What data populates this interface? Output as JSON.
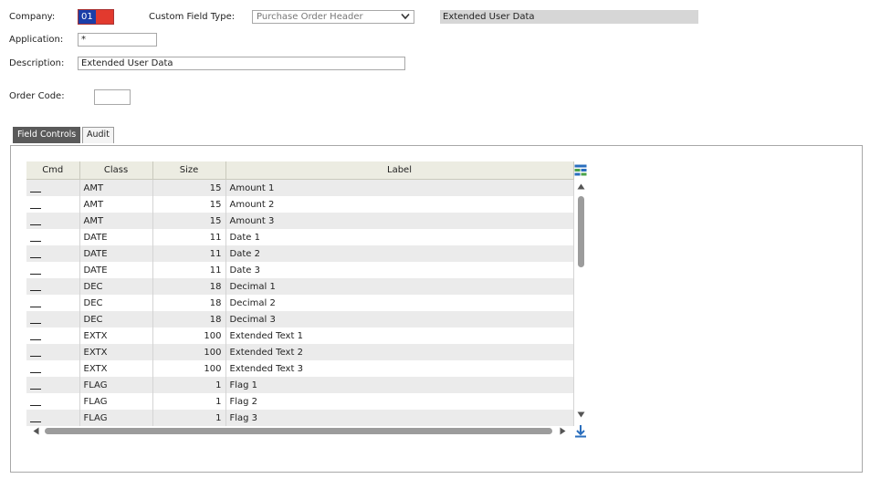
{
  "header": {
    "company_label": "Company:",
    "company_value": "01",
    "custom_field_type_label": "Custom Field Type:",
    "custom_field_type_value": "Purchase Order Header",
    "custom_field_type_desc": "Extended User Data",
    "application_label": "Application:",
    "application_value": "*",
    "description_label": "Description:",
    "description_value": "Extended User Data",
    "order_code_label": "Order Code:",
    "order_code_value": ""
  },
  "tabs": [
    {
      "label": "Field Controls",
      "active": true
    },
    {
      "label": "Audit",
      "active": false
    }
  ],
  "grid": {
    "columns": [
      "Cmd",
      "Class",
      "Size",
      "Label"
    ],
    "rows": [
      {
        "cmd": "",
        "class": "AMT",
        "size": "15",
        "label": "Amount 1"
      },
      {
        "cmd": "",
        "class": "AMT",
        "size": "15",
        "label": "Amount 2"
      },
      {
        "cmd": "",
        "class": "AMT",
        "size": "15",
        "label": "Amount 3"
      },
      {
        "cmd": "",
        "class": "DATE",
        "size": "11",
        "label": "Date 1"
      },
      {
        "cmd": "",
        "class": "DATE",
        "size": "11",
        "label": "Date 2"
      },
      {
        "cmd": "",
        "class": "DATE",
        "size": "11",
        "label": "Date 3"
      },
      {
        "cmd": "",
        "class": "DEC",
        "size": "18",
        "label": "Decimal 1"
      },
      {
        "cmd": "",
        "class": "DEC",
        "size": "18",
        "label": "Decimal 2"
      },
      {
        "cmd": "",
        "class": "DEC",
        "size": "18",
        "label": "Decimal 3"
      },
      {
        "cmd": "",
        "class": "EXTX",
        "size": "100",
        "label": "Extended Text 1"
      },
      {
        "cmd": "",
        "class": "EXTX",
        "size": "100",
        "label": "Extended Text 2"
      },
      {
        "cmd": "",
        "class": "EXTX",
        "size": "100",
        "label": "Extended Text 3"
      },
      {
        "cmd": "",
        "class": "FLAG",
        "size": "1",
        "label": "Flag 1"
      },
      {
        "cmd": "",
        "class": "FLAG",
        "size": "1",
        "label": "Flag 2"
      },
      {
        "cmd": "",
        "class": "FLAG",
        "size": "1",
        "label": "Flag 3"
      }
    ]
  },
  "icons": {
    "column_settings": "grid-columns-icon",
    "scroll_to_bottom": "download-arrow-icon",
    "scroll_up": "triangle-up-icon",
    "scroll_down": "triangle-down-icon",
    "scroll_left": "triangle-left-icon",
    "scroll_right": "triangle-right-icon"
  },
  "colors": {
    "company_bg": "#e23a2e",
    "company_selected": "#1a3ea8",
    "active_tab": "#5a5a5a",
    "header_bg": "#ecece2",
    "row_alt": "#ebebeb",
    "accent_icon": "#2a6ebd"
  }
}
